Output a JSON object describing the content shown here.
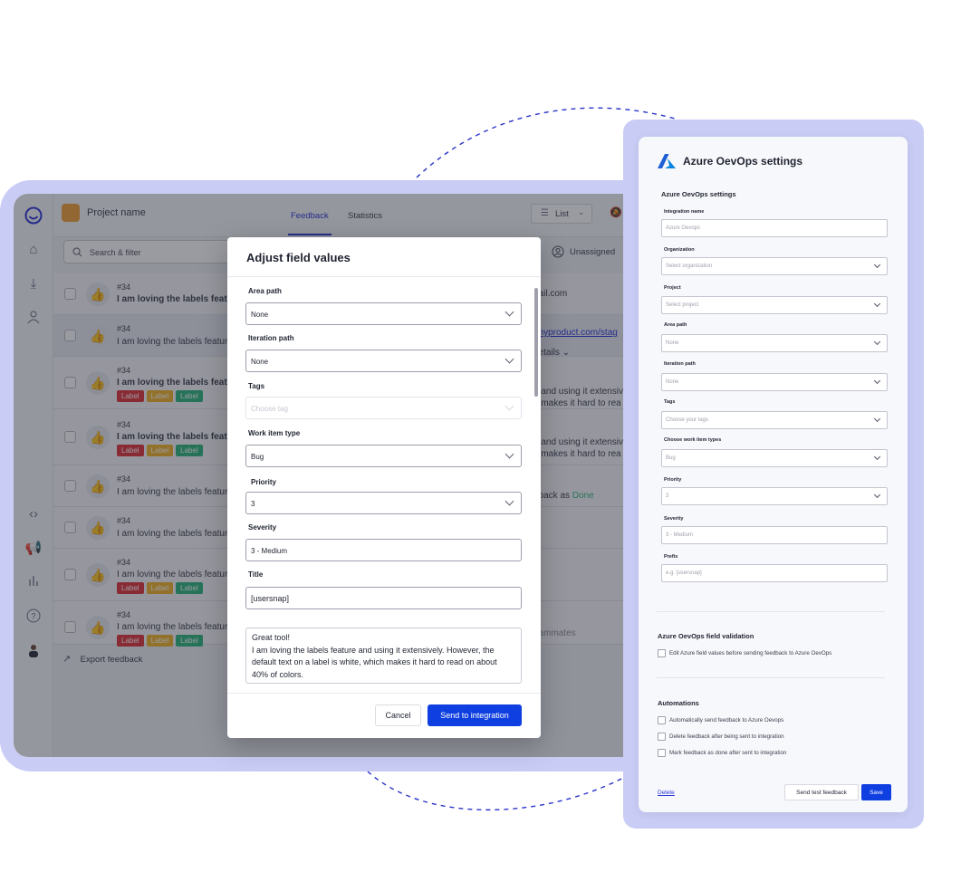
{
  "app": {
    "project_name": "Project name",
    "tabs": [
      "Feedback",
      "Statistics"
    ],
    "view_select": "List",
    "search_placeholder": "Search & filter",
    "assignee_filter": "Unassigned",
    "export_label": "Export feedback",
    "rows": [
      {
        "id": "#34",
        "text": "I am loving the labels feature",
        "labels": [],
        "right": "nail.com"
      },
      {
        "id": "#34",
        "text": "I am loving the labels feature",
        "labels": [],
        "right": "/myproduct.com/stag"
      },
      {
        "id": "#34",
        "text": "I am loving the labels feature",
        "labels": [
          "Label",
          "Label",
          "Label"
        ],
        "right": "details"
      },
      {
        "id": "#34",
        "text": "I am loving the labels feature",
        "labels": [
          "Label",
          "Label",
          "Label"
        ],
        "right": "e and using it extensiv"
      },
      {
        "id": "#34",
        "text": "I am loving the labels feature",
        "labels": [],
        "right": "h makes it hard to rea"
      },
      {
        "id": "#34",
        "text": "I am loving the labels feature",
        "labels": [],
        "right": ""
      },
      {
        "id": "#34",
        "text": "I am loving the labels feature",
        "labels": [
          "Label",
          "Label",
          "Label"
        ],
        "right": ""
      },
      {
        "id": "#34",
        "text": "I am loving the labels feature",
        "labels": [
          "Label",
          "Label",
          "Label"
        ],
        "right": "eammates"
      }
    ],
    "extra_right": [
      "e and using it extensiv",
      "h makes it hard to rea",
      "dback as ",
      "Done"
    ],
    "label_colors": [
      "#e0343b",
      "#f0b429",
      "#2fb67e"
    ]
  },
  "modal": {
    "title": "Adjust field values",
    "fields": [
      {
        "label": "Area path",
        "value": "None"
      },
      {
        "label": "Iteration path",
        "value": "None"
      },
      {
        "label": "Tags",
        "value": "Choose tag"
      },
      {
        "label": "Work item type",
        "value": "Bug"
      },
      {
        "label": "Priority",
        "value": "3"
      },
      {
        "label": "Severity",
        "value": "3 - Medium"
      },
      {
        "label": "Title",
        "value": "[usersnap]"
      }
    ],
    "description": "Great tool!\nI am loving the labels feature and using it extensively.  However, the default text on a label is white, which makes it hard to read on about 40% of colors.",
    "cancel": "Cancel",
    "send": "Send to integration"
  },
  "settings": {
    "title": "Azure OevOps settings",
    "section": "Azure OevOps settings",
    "fields": [
      {
        "label": "Integration name",
        "value": "Azure Oevops",
        "dropdown": false
      },
      {
        "label": "Organization",
        "value": "Select organization",
        "dropdown": true
      },
      {
        "label": "Project",
        "value": "Select project",
        "dropdown": true
      },
      {
        "label": "Area path",
        "value": "None",
        "dropdown": true
      },
      {
        "label": "Iteration path",
        "value": "None",
        "dropdown": true
      },
      {
        "label": "Tags",
        "value": "Choose your tags",
        "dropdown": true
      },
      {
        "label": "Choose work item types",
        "value": "Bug",
        "dropdown": true
      },
      {
        "label": "Priority",
        "value": "3",
        "dropdown": true
      },
      {
        "label": "Severity",
        "value": "3 - Medium",
        "dropdown": false
      },
      {
        "label": "Prefix",
        "value": "e.g. [usersnap]",
        "dropdown": false
      }
    ],
    "validation_title": "Azure OevOps field validation",
    "validation_option": "Edit Azure field values before sending feedback to Azure OevOps",
    "automations_title": "Automations",
    "automations": [
      "Automatically send feedback to Azure Oevops",
      "Delete feedback after being sent to integration",
      "Mark feedback as done after sent to integration"
    ],
    "delete": "Delete",
    "test": "Send test feedback",
    "save": "Save",
    "brand_color": "#0f3fe0"
  }
}
